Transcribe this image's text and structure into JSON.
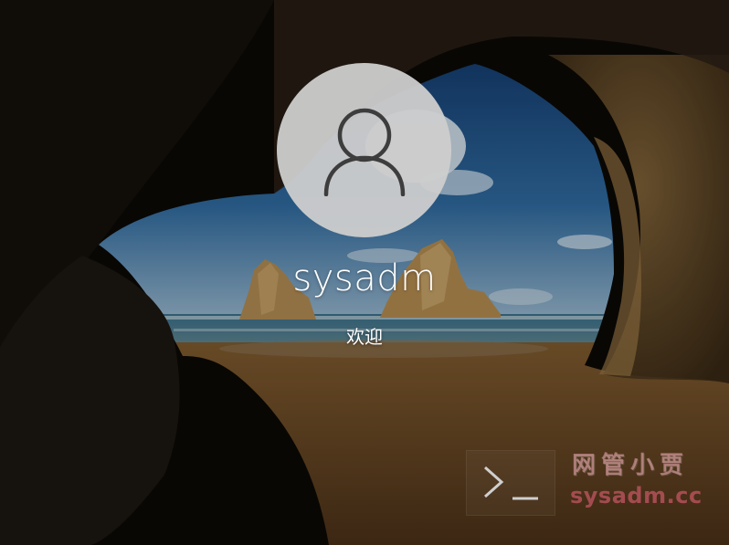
{
  "user": {
    "name": "sysadm",
    "avatar_icon": "user-silhouette-icon"
  },
  "status": {
    "text": "欢迎"
  },
  "accessibility": {
    "icon": "terminal-prompt-icon"
  },
  "watermark": {
    "cn": "网管小贾",
    "en": "sysadm.cc"
  },
  "colors": {
    "sky": "#1f4f86",
    "sea": "#3f6d86",
    "sand": "#6a4822",
    "rock": "#7b5a32",
    "cave": "#0b0906"
  }
}
